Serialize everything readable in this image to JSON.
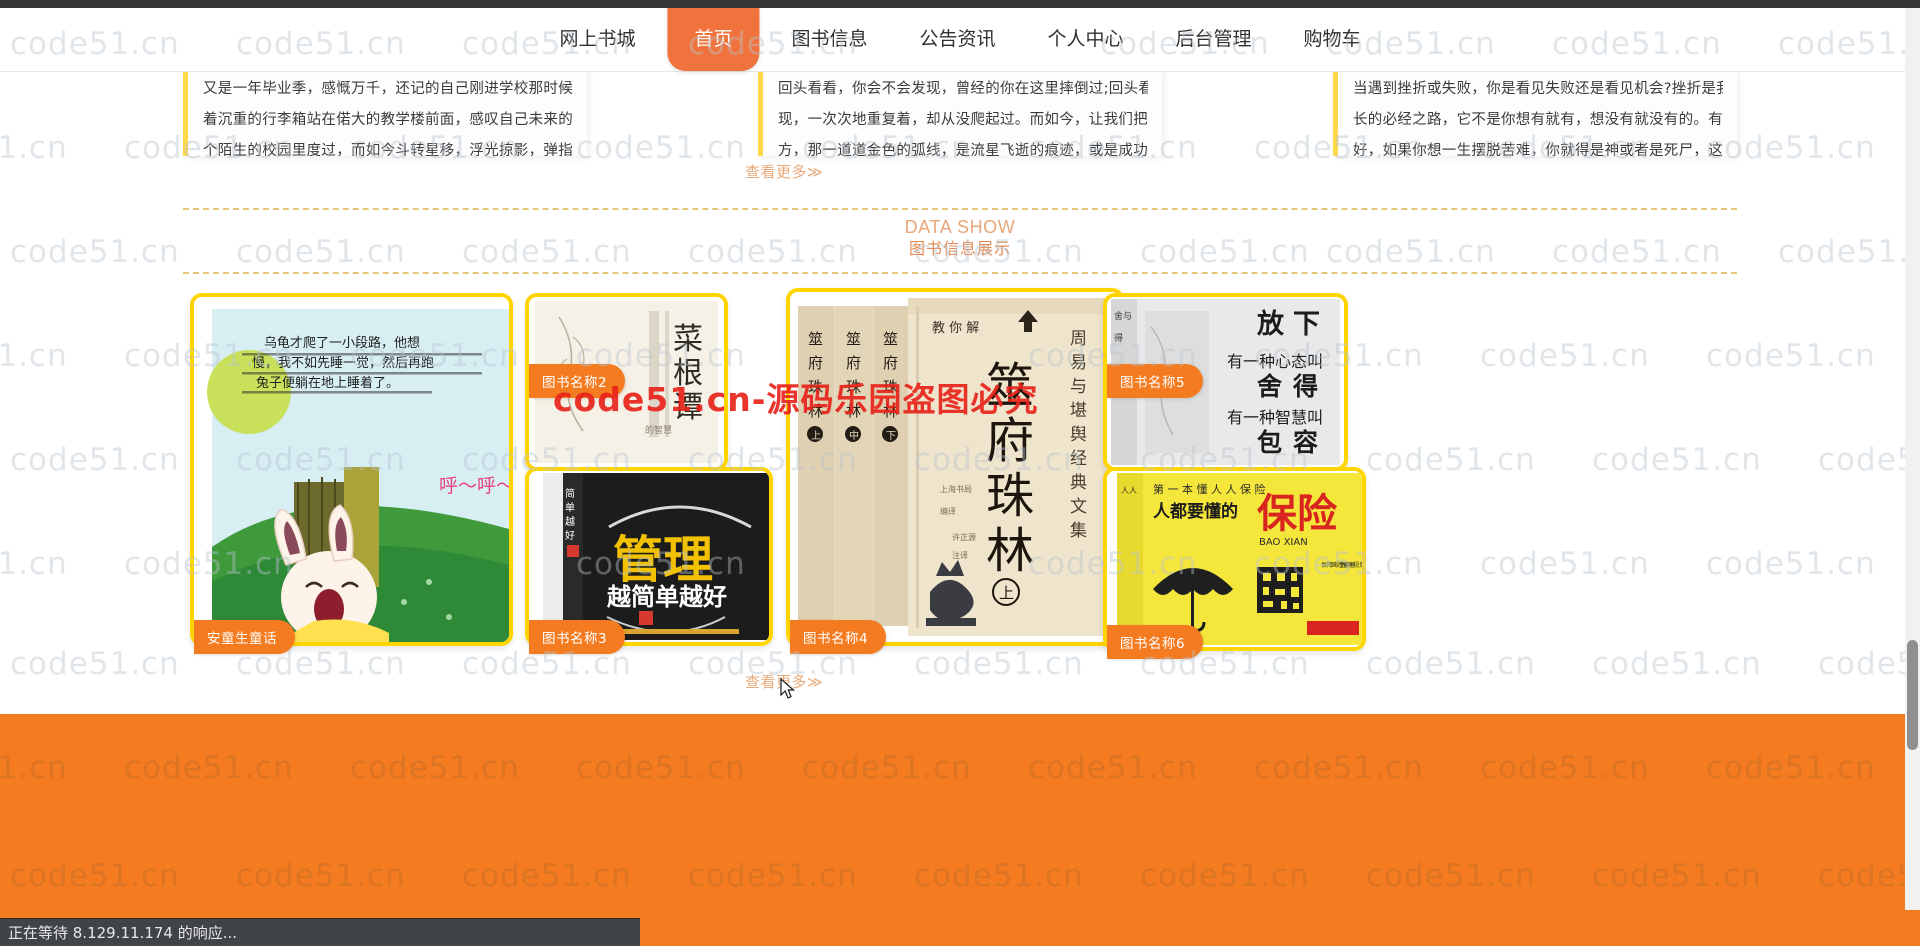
{
  "browser": {
    "status_text": "正在等待 8.129.11.174 的响应..."
  },
  "nav": {
    "items": [
      {
        "label": "网上书城",
        "active": false
      },
      {
        "label": "首页",
        "active": true
      },
      {
        "label": "图书信息",
        "active": false
      },
      {
        "label": "公告资讯",
        "active": false
      },
      {
        "label": "个人中心",
        "active": false
      },
      {
        "label": "后台管理",
        "active": false
      },
      {
        "label": "购物车",
        "active": false
      }
    ],
    "active_bg": "#f0733d"
  },
  "articles": {
    "cards": [
      {
        "line1": "又是一年毕业季，感慨万千，还记的自己刚进学校那时候的情景，我拖",
        "line2": "着沉重的行李箱站在偌大的教学楼前面，感叹自己未来的日子即将在这",
        "line3": "个陌生的校园里度过，而如今斗转星移，浮光掠影，弹指之间，那些..."
      },
      {
        "line1": "回头看看，你会不会发现，曾经的你在这里摔倒过;回头看看，你是否发",
        "line2": "现，一次次地重复着，却从没爬起过。而如今，让我们把视线转向前",
        "line3": "方，那一道道金色的弧线，是流星飞逝的痕迹，或是成功运行的轨道..."
      },
      {
        "line1": "当遇到挫折或失败，你是看见失败还是看见机会?挫折是我们每个人成",
        "line2": "长的必经之路，它不是你想有就有，想没有就没有的。有句名言说的",
        "line3": "好，如果你想一生摆脱苦难，你就得是神或者是死尸，这句话形象地..."
      }
    ],
    "more_label": "查看更多≫"
  },
  "section": {
    "title_en": "DATA SHOW",
    "title_cn": "图书信息展示"
  },
  "books": [
    {
      "id": "bk1",
      "tag": "安童生童话"
    },
    {
      "id": "bk2",
      "tag": "图书名称2"
    },
    {
      "id": "bk3",
      "tag": "图书名称3"
    },
    {
      "id": "bk4",
      "tag": "图书名称4"
    },
    {
      "id": "bk5",
      "tag": "图书名称5"
    },
    {
      "id": "bk6",
      "tag": "图书名称6"
    }
  ],
  "books_more_label": "查看更多≫",
  "watermark": {
    "tile_text": "code51.cn",
    "red_text": "code51.cn-源码乐园盗图必究"
  },
  "colors": {
    "accent_orange": "#f47b20",
    "nav_active": "#f0733d",
    "card_border_yellow": "#ffd500",
    "dashed_divider": "#e5c77a",
    "section_title": "#e9a679"
  }
}
